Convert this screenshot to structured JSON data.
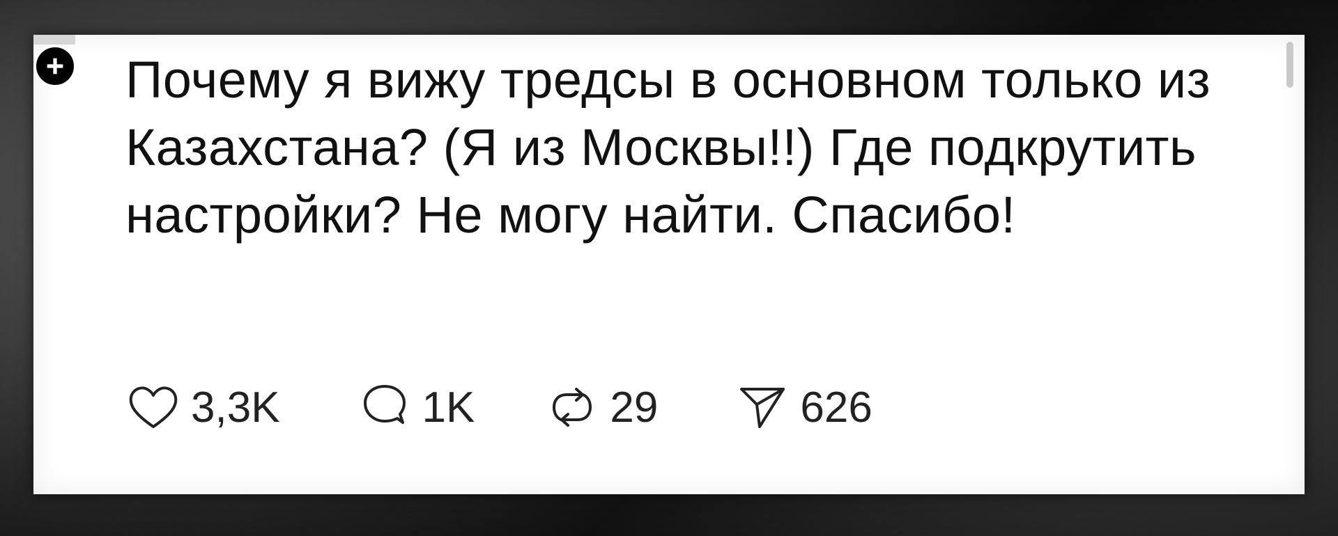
{
  "post": {
    "text": "Почему я вижу тредсы в основном только из Казахстана? (Я из Москвы!!) Где подкрутить настройки? Не могу найти. Спасибо!"
  },
  "actions": {
    "likes": {
      "icon": "heart-icon",
      "count": "3,3K"
    },
    "replies": {
      "icon": "comment-icon",
      "count": "1K"
    },
    "reposts": {
      "icon": "repost-icon",
      "count": "29"
    },
    "shares": {
      "icon": "send-icon",
      "count": "626"
    }
  },
  "follow_badge": {
    "icon": "plus-icon"
  },
  "colors": {
    "text": "#111111",
    "background": "#ffffff",
    "badge": "#000000"
  }
}
